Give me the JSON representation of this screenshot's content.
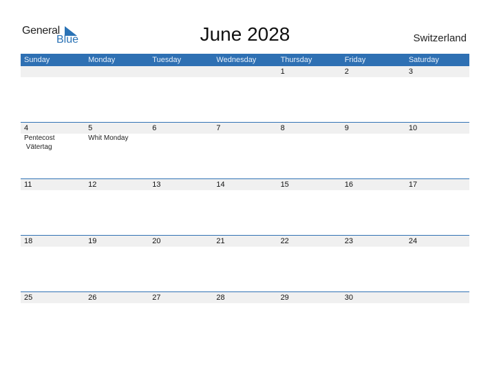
{
  "logo": {
    "line1": "General",
    "line2": "Blue"
  },
  "title": "June 2028",
  "country": "Switzerland",
  "colors": {
    "accent": "#2e70b3",
    "strip": "#f0f0f0"
  },
  "weekdays": [
    "Sunday",
    "Monday",
    "Tuesday",
    "Wednesday",
    "Thursday",
    "Friday",
    "Saturday"
  ],
  "weeks": [
    {
      "days": [
        "",
        "",
        "",
        "",
        "1",
        "2",
        "3"
      ],
      "events": [
        [],
        [],
        [],
        [],
        [],
        [],
        []
      ]
    },
    {
      "days": [
        "4",
        "5",
        "6",
        "7",
        "8",
        "9",
        "10"
      ],
      "events": [
        [
          "Pentecost",
          " Vätertag"
        ],
        [
          "Whit Monday"
        ],
        [],
        [],
        [],
        [],
        []
      ]
    },
    {
      "days": [
        "11",
        "12",
        "13",
        "14",
        "15",
        "16",
        "17"
      ],
      "events": [
        [],
        [],
        [],
        [],
        [],
        [],
        []
      ]
    },
    {
      "days": [
        "18",
        "19",
        "20",
        "21",
        "22",
        "23",
        "24"
      ],
      "events": [
        [],
        [],
        [],
        [],
        [],
        [],
        []
      ]
    },
    {
      "days": [
        "25",
        "26",
        "27",
        "28",
        "29",
        "30",
        ""
      ],
      "events": [
        [],
        [],
        [],
        [],
        [],
        [],
        []
      ]
    }
  ]
}
